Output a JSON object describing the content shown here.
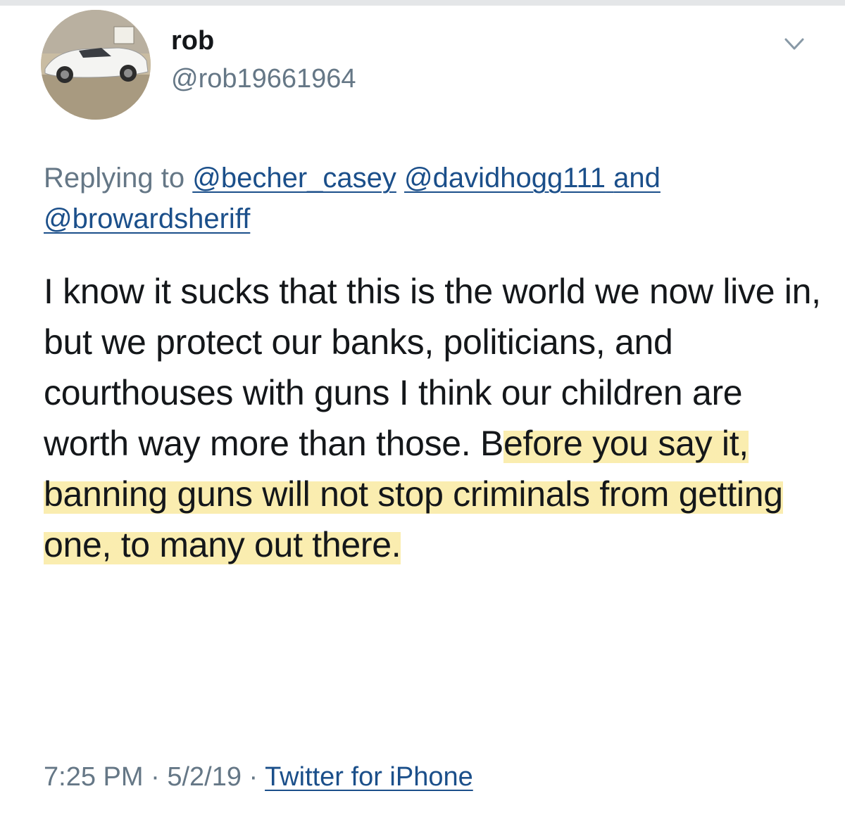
{
  "tweet": {
    "author": {
      "display_name": "rob",
      "handle": "@rob19661964",
      "avatar_icon": "avatar-photo-white-sports-car"
    },
    "menu_icon": "chevron-down-icon",
    "reply": {
      "prefix": "Replying to",
      "mentions": [
        "@becher_casey",
        "@davidhogg111"
      ],
      "conjunction": "and",
      "last_mention": "@browardsheriff"
    },
    "text_plain": "I know it sucks that this is the world we now live in, but we protect our banks, politicians, and courthouses with guns I think our children are worth way more than those. B",
    "text_highlighted": "efore you say it, banning guns will not stop criminals from getting one, to many out there.",
    "highlight_color": "#f5de6e",
    "time": "7:25 PM",
    "separator": "·",
    "date": "5/2/19",
    "source": "Twitter for iPhone"
  }
}
